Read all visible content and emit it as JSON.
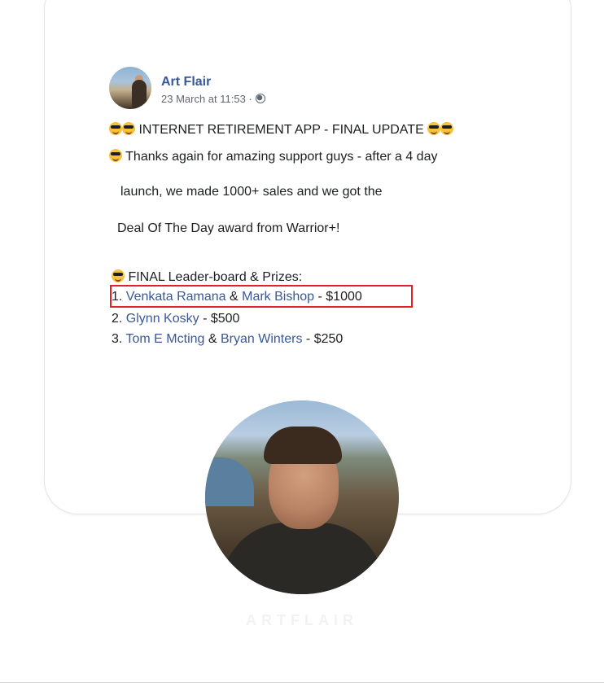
{
  "post": {
    "author": "Art Flair",
    "timestamp": "23 March at 11:53 ·",
    "privacy_icon": "globe-icon",
    "lines": {
      "headline": "INTERNET RETIREMENT APP - FINAL UPDATE",
      "thanks": "Thanks again for amazing support guys - after a 4 day",
      "launch": "launch, we made   1000+ sales and we got the",
      "award": "Deal Of The Day award from Warrior+!",
      "leaderboard": "FINAL Leader-board & Prizes:"
    },
    "leaderboard": [
      {
        "rank": "1.",
        "name1": "Venkata Ramana",
        "joiner": "&",
        "name2": "Mark Bishop",
        "prize": "- $1000"
      },
      {
        "rank": "2.",
        "name1": "Glynn Kosky",
        "prize": "- $500"
      },
      {
        "rank": "3.",
        "name1": "Tom E Mcting",
        "joiner": "&",
        "name2": "Bryan Winters",
        "prize": "- $250"
      }
    ]
  },
  "brand": "ARTFLAIR",
  "colors": {
    "link": "#385898",
    "highlight": "#e3202a",
    "text": "#1c1e21"
  }
}
